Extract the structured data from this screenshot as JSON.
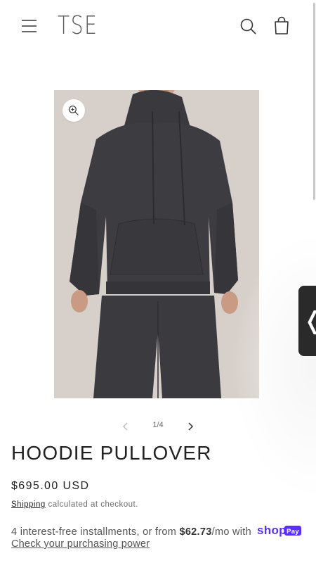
{
  "header": {
    "logo_text": "TSE",
    "menu_icon": "hamburger-menu-icon",
    "search_icon": "search-icon",
    "cart_icon": "cart-bag-icon"
  },
  "gallery": {
    "counter": "1/4",
    "zoom_icon": "zoom-in-icon",
    "prev_icon": "chevron-left-icon",
    "next_icon": "chevron-right-icon"
  },
  "side_tab": {
    "glyph": "❬"
  },
  "product": {
    "title": "HOODIE PULLOVER",
    "price": "$695.00 USD",
    "shipping_link": "Shipping",
    "shipping_note": " calculated at checkout."
  },
  "shop_pay": {
    "installments_prefix": "4 interest-free installments, or from ",
    "installment_amount": "$62.73",
    "installments_suffix": "/mo with ",
    "brand_shop": "shop",
    "brand_pay": "Pay",
    "purchasing_power_link": "Check your purchasing power"
  },
  "colors": {
    "sweater": "#3d3c41",
    "background": "#d7cfca",
    "shop_pay_purple": "#5a31f4"
  }
}
